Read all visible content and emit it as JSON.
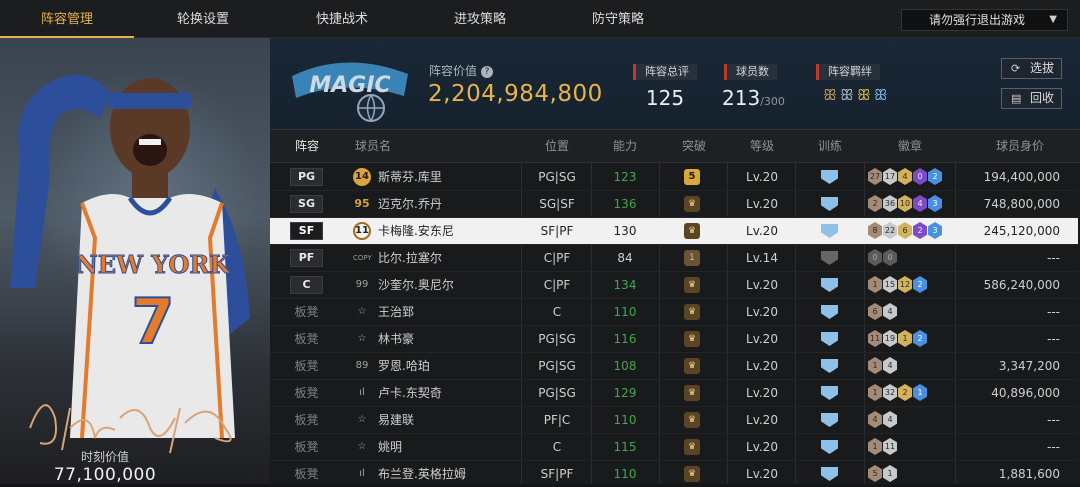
{
  "nav": {
    "tabs": [
      {
        "label": "阵容管理",
        "active": true
      },
      {
        "label": "轮换设置",
        "active": false
      },
      {
        "label": "快捷战术",
        "active": false
      },
      {
        "label": "进攻策略",
        "active": false
      },
      {
        "label": "防守策略",
        "active": false
      }
    ],
    "exit_select": "请勿强行退出游戏"
  },
  "player_card": {
    "jersey_team": "NEW YORK",
    "jersey_number": "7",
    "market_value_label": "时刻价值",
    "market_value": "77,100,000"
  },
  "team": {
    "logo_text": "MAGIC",
    "lineup_value_label": "阵容价值",
    "lineup_value": "2,204,984,800",
    "overall_label": "阵容总评",
    "overall": "125",
    "players_label": "球员数",
    "players_count": "213",
    "players_max": "/300",
    "bonds_label": "阵容羁绊",
    "buttons": {
      "draft": "选拔",
      "recycle": "回收"
    }
  },
  "table": {
    "headers": [
      "阵容",
      "球员名",
      "位置",
      "能力",
      "突破",
      "等级",
      "训练",
      "徽章",
      "球员身价"
    ],
    "rows": [
      {
        "slot": "PG",
        "bench": false,
        "tier": "14",
        "tier_style": "gold",
        "name": "斯蒂芬.库里",
        "position": "PG|SG",
        "ability": "123",
        "ability_color": "green",
        "breakthrough": "5",
        "brk_style": "big",
        "level": "Lv.20",
        "train": "blue",
        "badges": [
          [
            "b",
            "27"
          ],
          [
            "s",
            "17"
          ],
          [
            "g",
            "4"
          ],
          [
            "p",
            "0"
          ],
          [
            "bl",
            "2"
          ]
        ],
        "value": "194,400,000",
        "selected": false
      },
      {
        "slot": "SG",
        "bench": false,
        "tier": "95",
        "tier_style": "gold2",
        "name": "迈克尔.乔丹",
        "position": "SG|SF",
        "ability": "136",
        "ability_color": "green",
        "breakthrough": "♛",
        "brk_style": "",
        "level": "Lv.20",
        "train": "blue",
        "badges": [
          [
            "b",
            "2"
          ],
          [
            "s",
            "36"
          ],
          [
            "g",
            "10"
          ],
          [
            "p",
            "4"
          ],
          [
            "bl",
            "3"
          ]
        ],
        "value": "748,800,000",
        "selected": false
      },
      {
        "slot": "SF",
        "bench": false,
        "tier": "11",
        "tier_style": "ring",
        "name": "卡梅隆.安东尼",
        "position": "SF|PF",
        "ability": "130",
        "ability_color": "plain",
        "breakthrough": "♛",
        "brk_style": "",
        "level": "Lv.20",
        "train": "blue",
        "badges": [
          [
            "b",
            "8"
          ],
          [
            "s",
            "22"
          ],
          [
            "g",
            "6"
          ],
          [
            "p",
            "2"
          ],
          [
            "bl",
            "3"
          ]
        ],
        "value": "245,120,000",
        "selected": true
      },
      {
        "slot": "PF",
        "bench": false,
        "tier": "COPY",
        "tier_style": "copy",
        "name": "比尔.拉塞尔",
        "position": "C|PF",
        "ability": "84",
        "ability_color": "plain",
        "breakthrough": "1",
        "brk_style": "dim",
        "level": "Lv.14",
        "train": "gray",
        "badges": [
          [
            "x",
            "0"
          ],
          [
            "x",
            "0"
          ]
        ],
        "value": "---",
        "selected": false
      },
      {
        "slot": "C",
        "bench": false,
        "tier": "99",
        "tier_style": "gray",
        "name": "沙奎尔.奥尼尔",
        "position": "C|PF",
        "ability": "134",
        "ability_color": "green",
        "breakthrough": "♛",
        "brk_style": "",
        "level": "Lv.20",
        "train": "blue",
        "badges": [
          [
            "b",
            "1"
          ],
          [
            "s",
            "15"
          ],
          [
            "g",
            "12"
          ],
          [
            "bl",
            "2"
          ]
        ],
        "value": "586,240,000",
        "selected": false
      },
      {
        "slot": "板凳",
        "bench": true,
        "tier": "☆",
        "tier_style": "gray",
        "name": "王治郅",
        "position": "C",
        "ability": "110",
        "ability_color": "green",
        "breakthrough": "♛",
        "brk_style": "",
        "level": "Lv.20",
        "train": "blue",
        "badges": [
          [
            "b",
            "6"
          ],
          [
            "s",
            "4"
          ]
        ],
        "value": "---",
        "selected": false
      },
      {
        "slot": "板凳",
        "bench": true,
        "tier": "☆",
        "tier_style": "gray",
        "name": "林书豪",
        "position": "PG|SG",
        "ability": "116",
        "ability_color": "green",
        "breakthrough": "♛",
        "brk_style": "",
        "level": "Lv.20",
        "train": "blue",
        "badges": [
          [
            "b",
            "11"
          ],
          [
            "s",
            "19"
          ],
          [
            "g",
            "1"
          ],
          [
            "bl",
            "2"
          ]
        ],
        "value": "---",
        "selected": false
      },
      {
        "slot": "板凳",
        "bench": true,
        "tier": "89",
        "tier_style": "gray",
        "name": "罗恩.哈珀",
        "position": "PG|SG",
        "ability": "108",
        "ability_color": "green",
        "breakthrough": "♛",
        "brk_style": "",
        "level": "Lv.20",
        "train": "blue",
        "badges": [
          [
            "b",
            "1"
          ],
          [
            "s",
            "4"
          ]
        ],
        "value": "3,347,200",
        "selected": false
      },
      {
        "slot": "板凳",
        "bench": true,
        "tier": "ıl",
        "tier_style": "gray",
        "name": "卢卡.东契奇",
        "position": "PG|SG",
        "ability": "129",
        "ability_color": "green",
        "breakthrough": "♛",
        "brk_style": "",
        "level": "Lv.20",
        "train": "blue",
        "badges": [
          [
            "b",
            "1"
          ],
          [
            "s",
            "32"
          ],
          [
            "g",
            "2"
          ],
          [
            "bl",
            "1"
          ]
        ],
        "value": "40,896,000",
        "selected": false
      },
      {
        "slot": "板凳",
        "bench": true,
        "tier": "☆",
        "tier_style": "gray",
        "name": "易建联",
        "position": "PF|C",
        "ability": "110",
        "ability_color": "green",
        "breakthrough": "♛",
        "brk_style": "",
        "level": "Lv.20",
        "train": "blue",
        "badges": [
          [
            "b",
            "4"
          ],
          [
            "s",
            "4"
          ]
        ],
        "value": "---",
        "selected": false
      },
      {
        "slot": "板凳",
        "bench": true,
        "tier": "☆",
        "tier_style": "gray",
        "name": "姚明",
        "position": "C",
        "ability": "115",
        "ability_color": "green",
        "breakthrough": "♛",
        "brk_style": "",
        "level": "Lv.20",
        "train": "blue",
        "badges": [
          [
            "b",
            "1"
          ],
          [
            "s",
            "11"
          ]
        ],
        "value": "---",
        "selected": false
      },
      {
        "slot": "板凳",
        "bench": true,
        "tier": "ıl",
        "tier_style": "gray",
        "name": "布兰登.英格拉姆",
        "position": "SF|PF",
        "ability": "110",
        "ability_color": "green",
        "breakthrough": "♛",
        "brk_style": "",
        "level": "Lv.20",
        "train": "blue",
        "badges": [
          [
            "b",
            "5"
          ],
          [
            "s",
            "1"
          ]
        ],
        "value": "1,881,600",
        "selected": false
      }
    ]
  },
  "colors": {
    "accent": "#e6b24a",
    "ability_green": "#3fa84c",
    "selected_row": "#f1f1f1"
  },
  "icons": {
    "question": "question-circle-icon",
    "draft": "refresh-icon",
    "recycle": "trash-icon",
    "bonds": "team-bond-icon",
    "dropdown": "chevron-down-icon"
  }
}
